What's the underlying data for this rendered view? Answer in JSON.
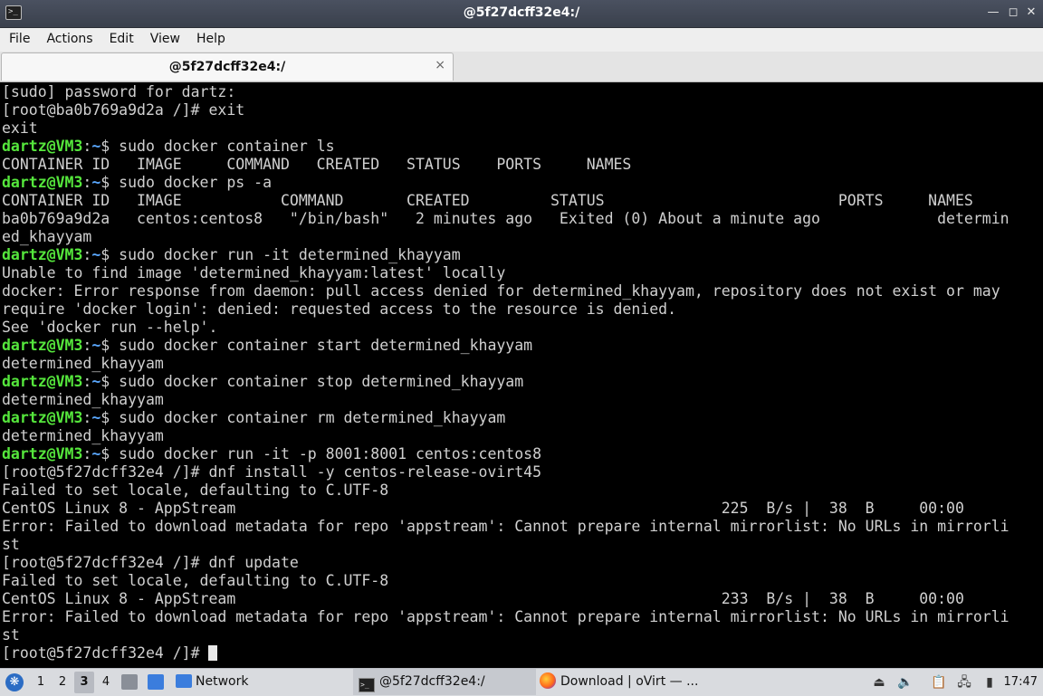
{
  "window": {
    "title": "@5f27dcff32e4:/"
  },
  "menubar": {
    "items": [
      "File",
      "Actions",
      "Edit",
      "View",
      "Help"
    ]
  },
  "tab": {
    "label": "@5f27dcff32e4:/",
    "close_glyph": "×"
  },
  "terminal": {
    "user_host": "dartz@VM3",
    "dir": "~",
    "prompt_end": "$ ",
    "lines": [
      {
        "text": "[sudo] password for dartz:"
      },
      {
        "text": "[root@ba0b769a9d2a /]# exit"
      },
      {
        "text": "exit"
      },
      {
        "prompt": true,
        "text": "sudo docker container ls"
      },
      {
        "text": "CONTAINER ID   IMAGE     COMMAND   CREATED   STATUS    PORTS     NAMES"
      },
      {
        "prompt": true,
        "text": "sudo docker ps -a"
      },
      {
        "text": "CONTAINER ID   IMAGE           COMMAND       CREATED         STATUS                          PORTS     NAMES"
      },
      {
        "text": "ba0b769a9d2a   centos:centos8   \"/bin/bash\"   2 minutes ago   Exited (0) About a minute ago             determin"
      },
      {
        "text": "ed_khayyam"
      },
      {
        "prompt": true,
        "text": "sudo docker run -it determined_khayyam"
      },
      {
        "text": "Unable to find image 'determined_khayyam:latest' locally"
      },
      {
        "text": "docker: Error response from daemon: pull access denied for determined_khayyam, repository does not exist or may"
      },
      {
        "text": "require 'docker login': denied: requested access to the resource is denied."
      },
      {
        "text": "See 'docker run --help'."
      },
      {
        "prompt": true,
        "text": "sudo docker container start determined_khayyam"
      },
      {
        "text": "determined_khayyam"
      },
      {
        "prompt": true,
        "text": "sudo docker container stop determined_khayyam"
      },
      {
        "text": "determined_khayyam"
      },
      {
        "prompt": true,
        "text": "sudo docker container rm determined_khayyam"
      },
      {
        "text": "determined_khayyam"
      },
      {
        "prompt": true,
        "text": "sudo docker run -it -p 8001:8001 centos:centos8"
      },
      {
        "text": "[root@5f27dcff32e4 /]# dnf install -y centos-release-ovirt45"
      },
      {
        "text": "Failed to set locale, defaulting to C.UTF-8"
      },
      {
        "text": "CentOS Linux 8 - AppStream                                                      225  B/s |  38  B     00:00"
      },
      {
        "text": "Error: Failed to download metadata for repo 'appstream': Cannot prepare internal mirrorlist: No URLs in mirrorli"
      },
      {
        "text": "st"
      },
      {
        "text": "[root@5f27dcff32e4 /]# dnf update"
      },
      {
        "text": "Failed to set locale, defaulting to C.UTF-8"
      },
      {
        "text": "CentOS Linux 8 - AppStream                                                      233  B/s |  38  B     00:00"
      },
      {
        "text": "Error: Failed to download metadata for repo 'appstream': Cannot prepare internal mirrorlist: No URLs in mirrorli"
      },
      {
        "text": "st"
      },
      {
        "text": "[root@5f27dcff32e4 /]# ",
        "cursor": true
      }
    ]
  },
  "taskbar": {
    "workspaces": [
      "1",
      "2",
      "3",
      "4"
    ],
    "active_workspace": "3",
    "network_label": "Network",
    "tasks": [
      {
        "label": "@5f27dcff32e4:/",
        "icon": "terminal-icon",
        "active": true
      },
      {
        "label": "Download | oVirt — ...",
        "icon": "firefox-icon",
        "active": false
      }
    ],
    "clock": "17:47"
  },
  "colors": {
    "prompt_user": "#55e63c",
    "prompt_dir": "#5aa8ff",
    "terminal_bg": "#000000",
    "terminal_fg": "#d0d0d0"
  }
}
